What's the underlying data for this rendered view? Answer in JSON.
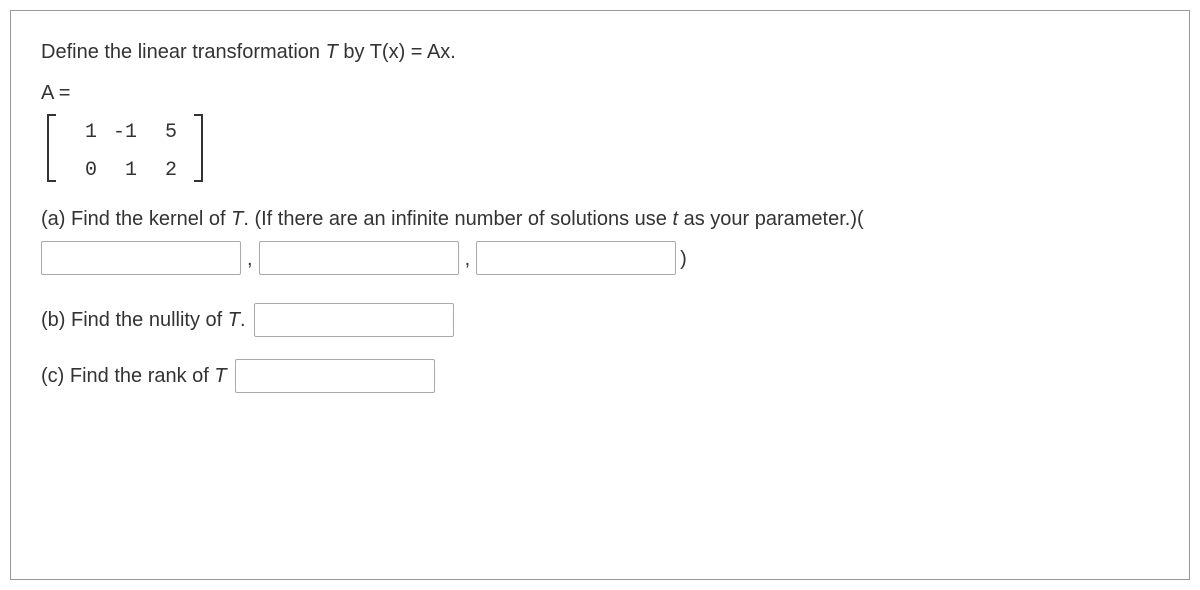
{
  "prompt": {
    "prefix": "Define the linear transformation ",
    "T": "T",
    "mid": " by  ",
    "eq_lhs": "T(x)",
    "equals": " = ",
    "eq_rhs": "Ax",
    "period": "."
  },
  "matrix": {
    "label_lhs": "A",
    "label_eq": " =",
    "rows": [
      [
        "1",
        "-1",
        "5"
      ],
      [
        "0",
        "1",
        "2"
      ]
    ]
  },
  "partA": {
    "label": "(a) Find the kernel of ",
    "T": "T",
    "period": ". ",
    "hint": "(If there are an infinite number of solutions use ",
    "param": "t",
    "hint2": " as your parameter.)",
    "open_paren": "(",
    "comma1": ",",
    "comma2": ",",
    "close_paren": ")"
  },
  "partB": {
    "label": "(b) Find the nullity of ",
    "T": "T",
    "period": "."
  },
  "partC": {
    "label": "(c) Find the rank of ",
    "T": "T"
  }
}
